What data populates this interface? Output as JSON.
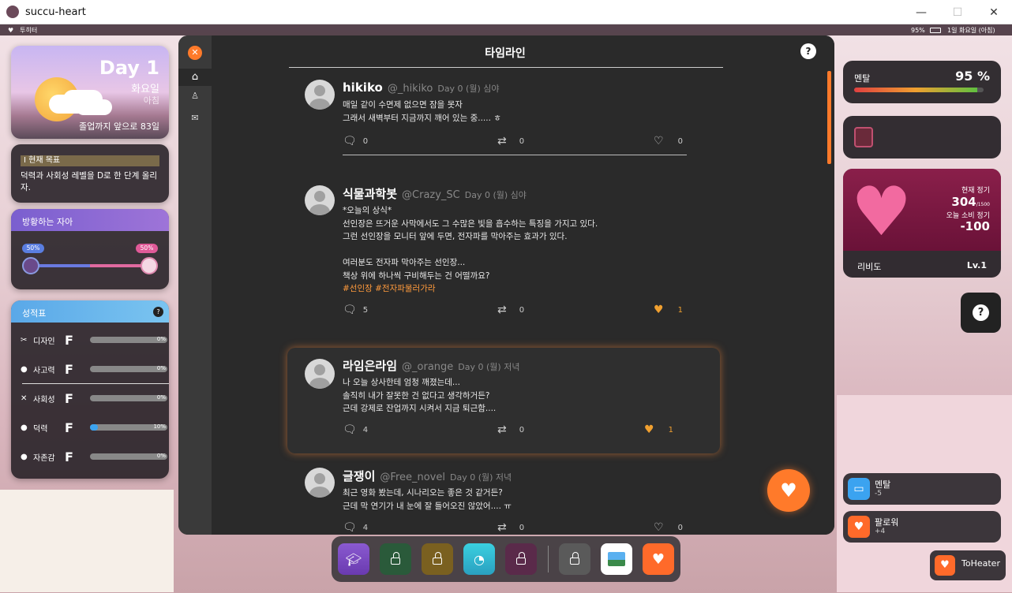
{
  "window": {
    "title": "succu-heart"
  },
  "status_bar": {
    "left": "투히터",
    "battery": "95%",
    "date": "1일 화요일 (아침)"
  },
  "day_card": {
    "day": "Day 1",
    "weekday": "화요일",
    "time_of_day": "아침",
    "countdown": "졸업까지 앞으로 83일"
  },
  "goal_card": {
    "heading": "I 현재 목표",
    "text": "덕력과 사회성 레벨을 D로 한 단계 올리자."
  },
  "ego_card": {
    "title": "방황하는 자아",
    "left_pct": "50%",
    "right_pct": "50%",
    "left_value": 0.5
  },
  "grades_card": {
    "title": "성적표",
    "help": "?",
    "rows": [
      {
        "icon": "design-icon",
        "label": "디자인",
        "grade": "F",
        "pct": "0%",
        "value": 0
      },
      {
        "icon": "thinking-icon",
        "label": "사고력",
        "grade": "F",
        "pct": "0%",
        "value": 0
      },
      {
        "icon": "social-icon",
        "label": "사회성",
        "grade": "F",
        "pct": "0%",
        "value": 0
      },
      {
        "icon": "otaku-icon",
        "label": "덕력",
        "grade": "F",
        "pct": "10%",
        "value": 0.1
      },
      {
        "icon": "selfesteem-icon",
        "label": "자존감",
        "grade": "F",
        "pct": "0%",
        "value": 0
      }
    ]
  },
  "timeline": {
    "title": "타임라인",
    "help": "?",
    "posts": [
      {
        "name": "hikiko",
        "handle": "@_hikiko",
        "time": "Day 0 (월) 심야",
        "lines": [
          "매일 같이 수면제 없으면 잠을 못자",
          "그래서 새벽부터 지금까지 깨어 있는 중..... ㅎ"
        ],
        "tags": "",
        "replies": "0",
        "retweets": "0",
        "likes": "0",
        "liked": false
      },
      {
        "name": "식물과학봇",
        "handle": "@Crazy_SC",
        "time": "Day 0 (월) 심야",
        "lines": [
          "*오늘의 상식*",
          "선인장은 뜨거운 사막에서도 그 수많은 빛을 흡수하는 특징을 가지고 있다.",
          "그런 선인장을 모니터 앞에 두면, 전자파를 막아주는 효과가 있다.",
          "",
          "여러분도 전자파 막아주는 선인장...",
          "책상 위에 하나씩 구비해두는 건 어떨까요?"
        ],
        "tags": "#선인장 #전자파물러가라",
        "replies": "5",
        "retweets": "0",
        "likes": "1",
        "liked": true
      },
      {
        "name": "라임은라임",
        "handle": "@_orange",
        "time": "Day 0 (월) 저녁",
        "lines": [
          "나 오늘 상사한테 엄청 깨졌는데...",
          "솔직히 내가 잘못한 건 없다고 생각하거든?",
          "근데 강제로 잔업까지 시켜서 지금 퇴근함...."
        ],
        "tags": "",
        "replies": "4",
        "retweets": "0",
        "likes": "1",
        "liked": true
      },
      {
        "name": "글쟁이",
        "handle": "@Free_novel",
        "time": "Day 0 (월) 저녁",
        "lines": [
          "최근 영화 봤는데, 시나리오는 좋은 것 같거든?",
          "근데 막 연기가 내 눈에 잘 들어오진 않았어.... ㅠ"
        ],
        "tags": "",
        "replies": "4",
        "retweets": "0",
        "likes": "0",
        "liked": false
      }
    ]
  },
  "mental_card": {
    "label": "멘탈",
    "value": "95 %",
    "level": 0.95
  },
  "heart_card": {
    "current_label": "현재 정기",
    "current": "304",
    "current_max": "/1500",
    "spend_label": "오늘 소비 정기",
    "spend": "-100",
    "name": "리비도",
    "level": "Lv.1"
  },
  "notifications": [
    {
      "title": "멘탈",
      "sub": "-5",
      "color": "#3ba3f0"
    },
    {
      "title": "팔로워",
      "sub": "+4",
      "color": "#ff6a2a"
    }
  ],
  "toheater": {
    "label": "ToHeater"
  },
  "help_button": "?",
  "colors": {
    "accent": "#ff7a2a",
    "panel": "#2a2a2a",
    "sidebar": "#3a3a3a",
    "like": "#f0a030",
    "tag": "#ff9a3c"
  }
}
